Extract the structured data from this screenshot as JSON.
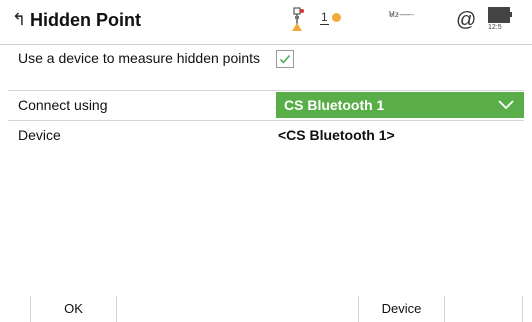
{
  "header": {
    "title": "Hidden Point",
    "satellite_count": "1",
    "angles": {
      "hz": "Hz -----",
      "v": "V  -----"
    },
    "at_symbol": "@",
    "battery_time": "12:5"
  },
  "rows": {
    "measure_device": {
      "label": "Use a device to measure hidden points",
      "checked": true
    },
    "connect_using": {
      "label": "Connect using",
      "value": "CS Bluetooth 1"
    },
    "device": {
      "label": "Device",
      "value": "<CS Bluetooth 1>"
    }
  },
  "softkeys": {
    "f1": "OK",
    "f2": "",
    "f3": "Device",
    "f4": ""
  },
  "colors": {
    "accent_green": "#5aae4a",
    "check_green": "#4caf50",
    "status_orange": "#f2a93b"
  }
}
